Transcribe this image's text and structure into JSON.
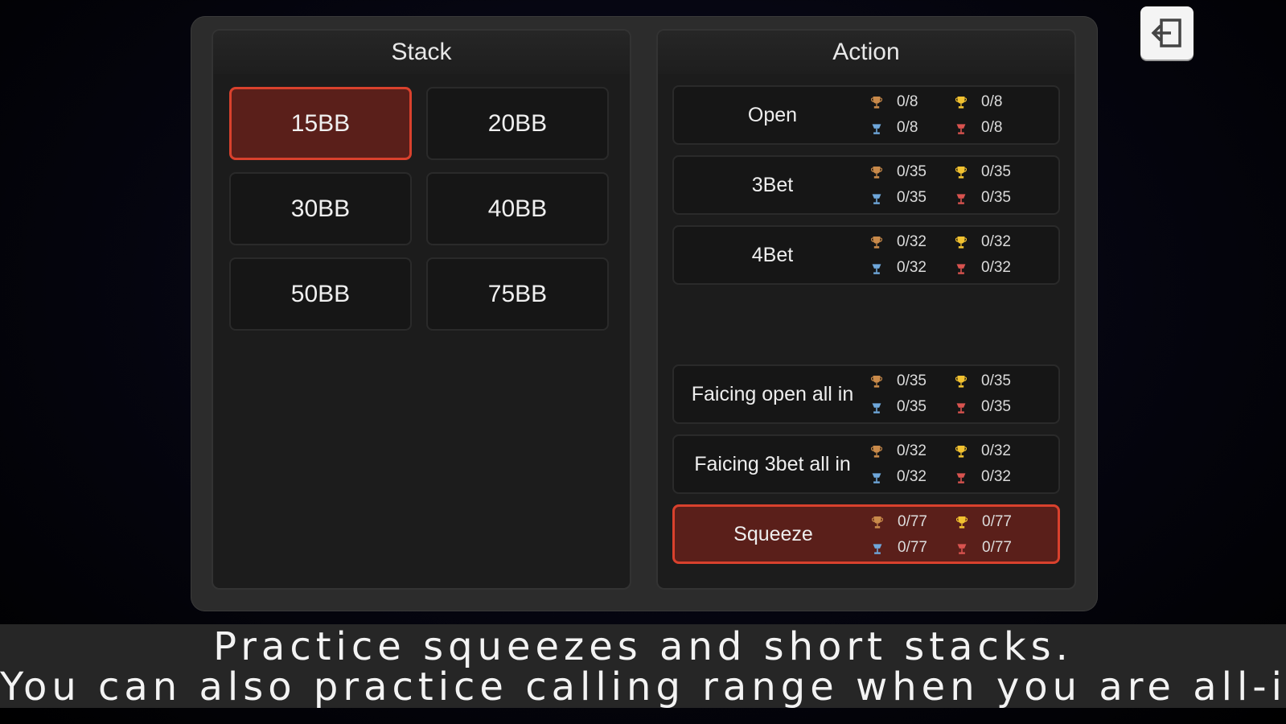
{
  "stack": {
    "title": "Stack",
    "options": [
      {
        "label": "15BB",
        "selected": true
      },
      {
        "label": "20BB",
        "selected": false
      },
      {
        "label": "30BB",
        "selected": false
      },
      {
        "label": "40BB",
        "selected": false
      },
      {
        "label": "50BB",
        "selected": false
      },
      {
        "label": "75BB",
        "selected": false
      }
    ]
  },
  "action": {
    "title": "Action",
    "rows": [
      {
        "label": "Open",
        "stats": [
          "0/8",
          "0/8",
          "0/8",
          "0/8"
        ],
        "selected": false
      },
      {
        "label": "3Bet",
        "stats": [
          "0/35",
          "0/35",
          "0/35",
          "0/35"
        ],
        "selected": false
      },
      {
        "label": "4Bet",
        "stats": [
          "0/32",
          "0/32",
          "0/32",
          "0/32"
        ],
        "selected": false
      },
      {
        "label": "Faicing open all in",
        "stats": [
          "0/35",
          "0/35",
          "0/35",
          "0/35"
        ],
        "selected": false
      },
      {
        "label": "Faicing 3bet all in",
        "stats": [
          "0/32",
          "0/32",
          "0/32",
          "0/32"
        ],
        "selected": false
      },
      {
        "label": "Squeeze",
        "stats": [
          "0/77",
          "0/77",
          "0/77",
          "0/77"
        ],
        "selected": true
      }
    ],
    "trophy_icons": [
      "bronze-trophy-icon",
      "gold-trophy-icon",
      "silver-trophy-icon",
      "red-trophy-icon"
    ]
  },
  "caption": {
    "line1": "Practice squeezes and short stacks.",
    "line2": "You can also practice calling range when you are all-in!"
  },
  "exit": {
    "icon": "exit-icon"
  },
  "colors": {
    "selected_bg": "#5a1f1a",
    "selected_border": "#d9412d",
    "bronze": "#c98a4a",
    "gold": "#f2c230",
    "silver": "#6fa8dc",
    "red": "#d9534f"
  }
}
